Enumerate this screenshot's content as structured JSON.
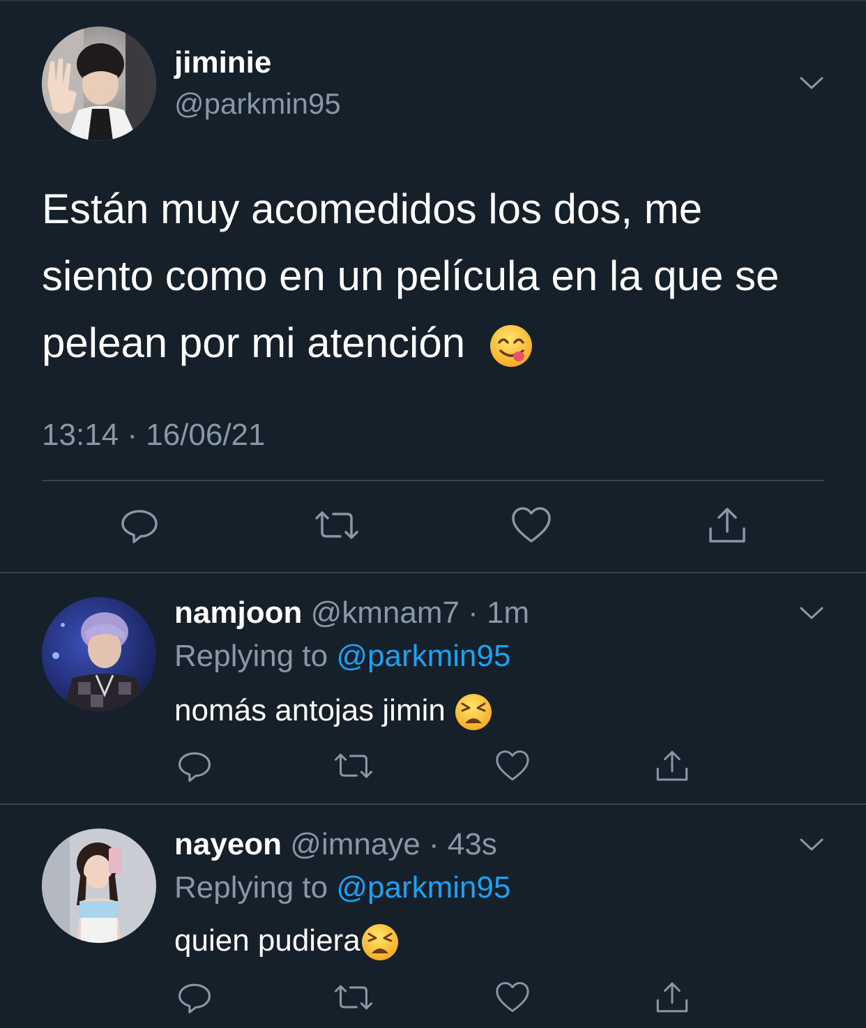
{
  "main_tweet": {
    "name": "jiminie",
    "handle": "@parkmin95",
    "text": "Están muy acomedidos los dos, me siento como en un película en la que se pelean por mi atención",
    "emoji": "face-savoring-food-emoji",
    "time": "13:14",
    "date": "16/06/21",
    "meta_separator": " · "
  },
  "replies": [
    {
      "name": "namjoon",
      "handle": "@kmnam7",
      "dot": " · ",
      "time": "1m",
      "replying_label": "Replying to ",
      "replying_to": "@parkmin95",
      "text": "nomás antojas jimin ",
      "emoji": "tired-face-emoji"
    },
    {
      "name": "nayeon",
      "handle": "@imnaye",
      "dot": " · ",
      "time": "43s",
      "replying_label": "Replying to ",
      "replying_to": "@parkmin95",
      "text": "quien pudiera",
      "emoji": "tired-face-emoji"
    }
  ],
  "icons": [
    "reply-icon",
    "retweet-icon",
    "like-icon",
    "share-icon",
    "chevron-down-icon"
  ],
  "colors": {
    "background": "#15202b",
    "secondary_text": "#8899a6",
    "mention": "#1da1f2",
    "divider": "#38444d"
  }
}
